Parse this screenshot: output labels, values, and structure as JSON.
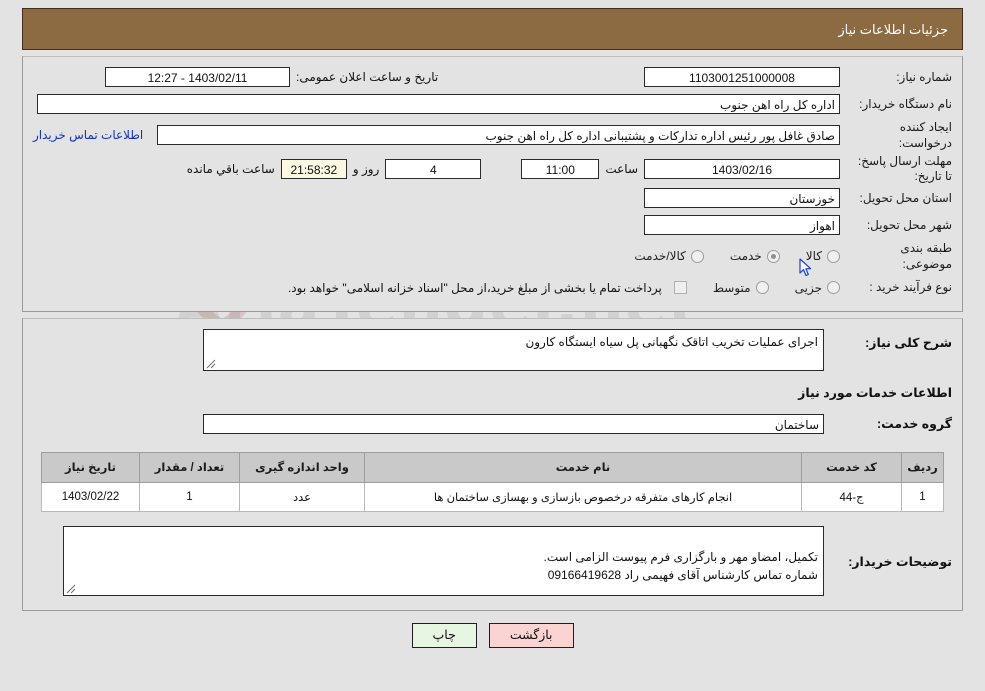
{
  "header": {
    "title": "جزئیات اطلاعات نیاز"
  },
  "watermark": {
    "text": "AriaTender.net",
    "shield_icon": "shield-icon"
  },
  "summary": {
    "need_number_label": "شماره نیاز:",
    "need_number_value": "1103001251000008",
    "announce_datetime_label": "تاریخ و ساعت اعلان عمومی:",
    "announce_datetime_value": "1403/02/11 - 12:27",
    "buyer_org_label": "نام دستگاه خریدار:",
    "buyer_org_value": "اداره کل راه اهن جنوب",
    "creator_label": "ایجاد کننده درخواست:",
    "creator_value": "صادق غافل پور رئیس اداره تدارکات و پشتیبانی اداره کل راه اهن جنوب",
    "contact_link": "اطلاعات تماس خریدار",
    "deadline_label": "مهلت ارسال پاسخ: تا تاریخ:",
    "deadline_date": "1403/02/16",
    "deadline_hour_label": "ساعت",
    "deadline_hour": "11:00",
    "remaining_days": "4",
    "remaining_days_label": "روز و",
    "remaining_time": "21:58:32",
    "remaining_time_label": "ساعت باقي مانده",
    "province_label": "استان محل تحویل:",
    "province_value": "خوزستان",
    "city_label": "شهر محل تحویل:",
    "city_value": "اهواز",
    "category_label": "طبقه بندی موضوعی:",
    "category_options": [
      {
        "label": "کالا",
        "checked": false
      },
      {
        "label": "خدمت",
        "checked": true
      },
      {
        "label": "کالا/خدمت",
        "checked": false
      }
    ],
    "process_label": "نوع فرآیند خرید :",
    "process_options": [
      {
        "label": "جزیی",
        "checked": false
      },
      {
        "label": "متوسط",
        "checked": false
      }
    ],
    "treasury_note": "پرداخت تمام یا بخشی از مبلغ خرید،از محل \"اسناد خزانه اسلامی\" خواهد بود."
  },
  "details": {
    "general_desc_label": "شرح کلی نیاز:",
    "general_desc_value": "اجرای عملیات تخریب اتاقک نگهبانی پل سیاه ایستگاه کارون",
    "services_section_title": "اطلاعات خدمات مورد نیاز",
    "service_group_label": "گروه خدمت:",
    "service_group_value": "ساختمان",
    "buyer_notes_label": "توضیحات خریدار:",
    "buyer_notes_value": "تکمیل، امضاو مهر و بارگزاری فرم پیوست الزامی است.\nشماره تماس کارشناس   آقای فهیمی راد 09166419628"
  },
  "items_table": {
    "columns": [
      "ردیف",
      "کد خدمت",
      "نام خدمت",
      "واحد اندازه گیری",
      "تعداد / مقدار",
      "تاریخ نیاز"
    ],
    "rows": [
      {
        "row": "1",
        "code": "ج-44",
        "name": "انجام کارهای متفرقه درخصوص بازسازی و بهسازی ساختمان ها",
        "unit": "عدد",
        "quantity": "1",
        "need_date": "1403/02/22"
      }
    ]
  },
  "buttons": {
    "print": "چاپ",
    "back": "بازگشت"
  },
  "colors": {
    "header_bg": "#8c6a42",
    "page_bg": "#e3e3e3",
    "link": "#1230c4",
    "print_btn": "#e7f6e3",
    "back_btn": "#fbd3d3",
    "table_header": "#c9c9c9",
    "cream_field": "#fbf8e3"
  }
}
